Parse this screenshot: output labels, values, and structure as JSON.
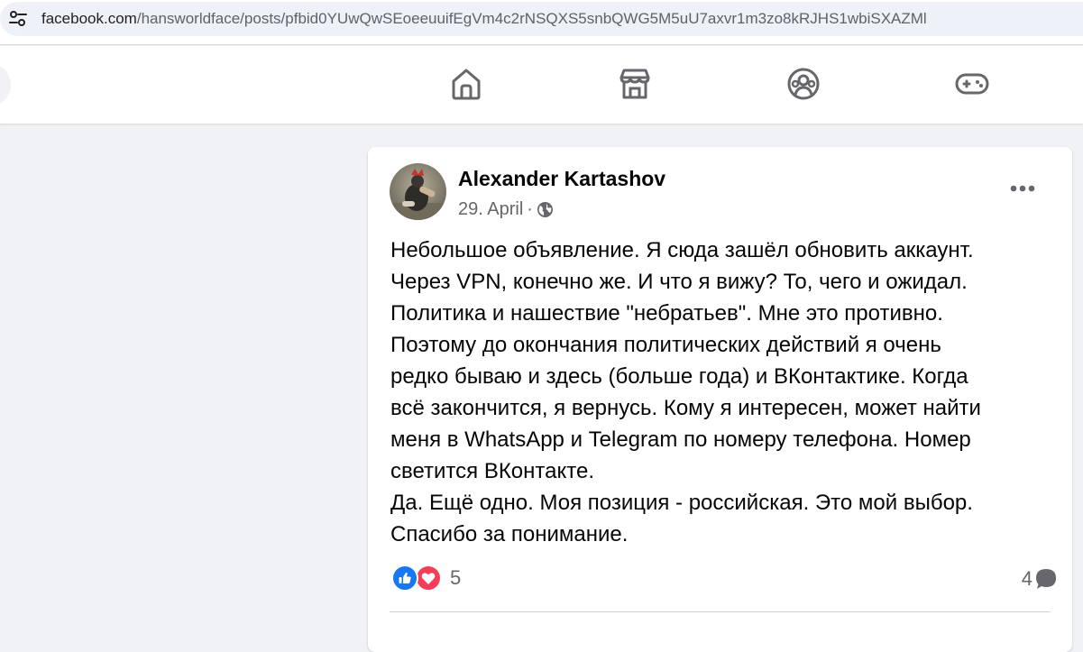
{
  "browser": {
    "url_host": "facebook.com",
    "url_path": "/hansworldface/posts/pfbid0YUwQwSEoeeuuifEgVm4c2rNSQXS5snbQWG5M5uU7axvr1m3zo8kRJHS1wbiSXAZMl",
    "site_info_icon": "tune-icon"
  },
  "nav": {
    "icons": [
      "home-icon",
      "marketplace-icon",
      "groups-icon",
      "gaming-icon"
    ]
  },
  "post": {
    "author": "Alexander Kartashov",
    "date": "29. April",
    "separator": "·",
    "audience_icon": "globe-icon",
    "more_icon": "more-options-icon",
    "lines": [
      "Небольшое объявление. Я сюда зашёл обновить аккаунт.",
      "Через VPN, конечно же. И что я вижу? То, чего и ожидал.",
      "Политика и нашествие \"небратьев\". Мне это противно.",
      "Поэтому до окончания политических действий я очень",
      "редко бываю и здесь (больше года) и ВКонтактике. Когда",
      "всё закончится, я вернусь. Кому я интересен, может найти",
      "меня в WhatsApp и Telegram по номеру телефона. Номер",
      "светится ВКонтакте.",
      "Да. Ещё одно. Моя позиция - российская. Это мой выбор.",
      "Спасибо за понимание."
    ],
    "reactions": {
      "types": [
        "like",
        "love"
      ],
      "count": "5"
    },
    "comments": {
      "count": "4"
    }
  },
  "colors": {
    "brand_blue": "#1877f2",
    "love_red": "#f33e58",
    "page_bg": "#f0f2f5",
    "secondary_text": "#65676b",
    "icon_gray": "#65676b"
  }
}
